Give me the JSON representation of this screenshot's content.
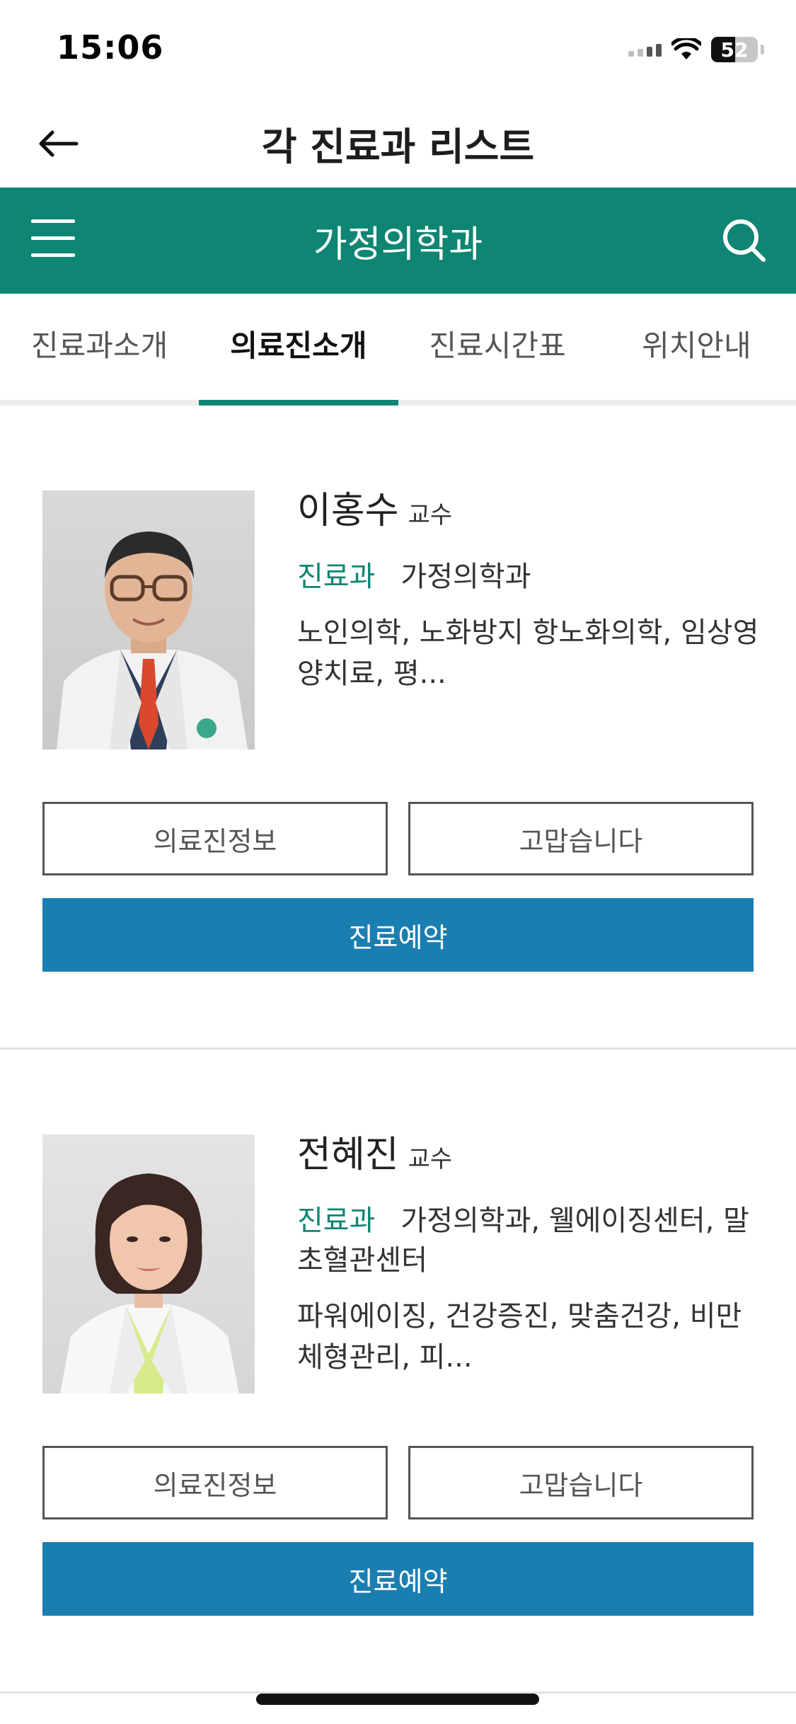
{
  "status_bar": {
    "time": "15:06",
    "battery": "52",
    "battery_level": 0.52
  },
  "header": {
    "title": "각 진료과 리스트"
  },
  "department_bar": {
    "title": "가정의학과"
  },
  "tabs": [
    {
      "label": "진료과소개"
    },
    {
      "label": "의료진소개"
    },
    {
      "label": "진료시간표"
    },
    {
      "label": "위치안내"
    }
  ],
  "doctors": [
    {
      "name": "이홍수",
      "title": "교수",
      "dept_label": "진료과",
      "dept": "가정의학과",
      "specialty": "노인의학, 노화방지 항노화의학, 임상영양치료, 평...",
      "info_button": "의료진정보",
      "thanks_button": "고맙습니다",
      "reserve_button": "진료예약"
    },
    {
      "name": "전혜진",
      "title": "교수",
      "dept_label": "진료과",
      "dept": "가정의학과, 웰에이징센터, 말초혈관센터",
      "specialty": "파워에이징, 건강증진, 맞춤건강, 비만체형관리, 피...",
      "info_button": "의료진정보",
      "thanks_button": "고맙습니다",
      "reserve_button": "진료예약"
    }
  ],
  "colors": {
    "brand_green": "#0f8573",
    "reserve_blue": "#1b7eb1"
  },
  "icons": {
    "back": "arrow-left-icon",
    "menu": "hamburger-menu-icon",
    "search": "search-icon"
  }
}
